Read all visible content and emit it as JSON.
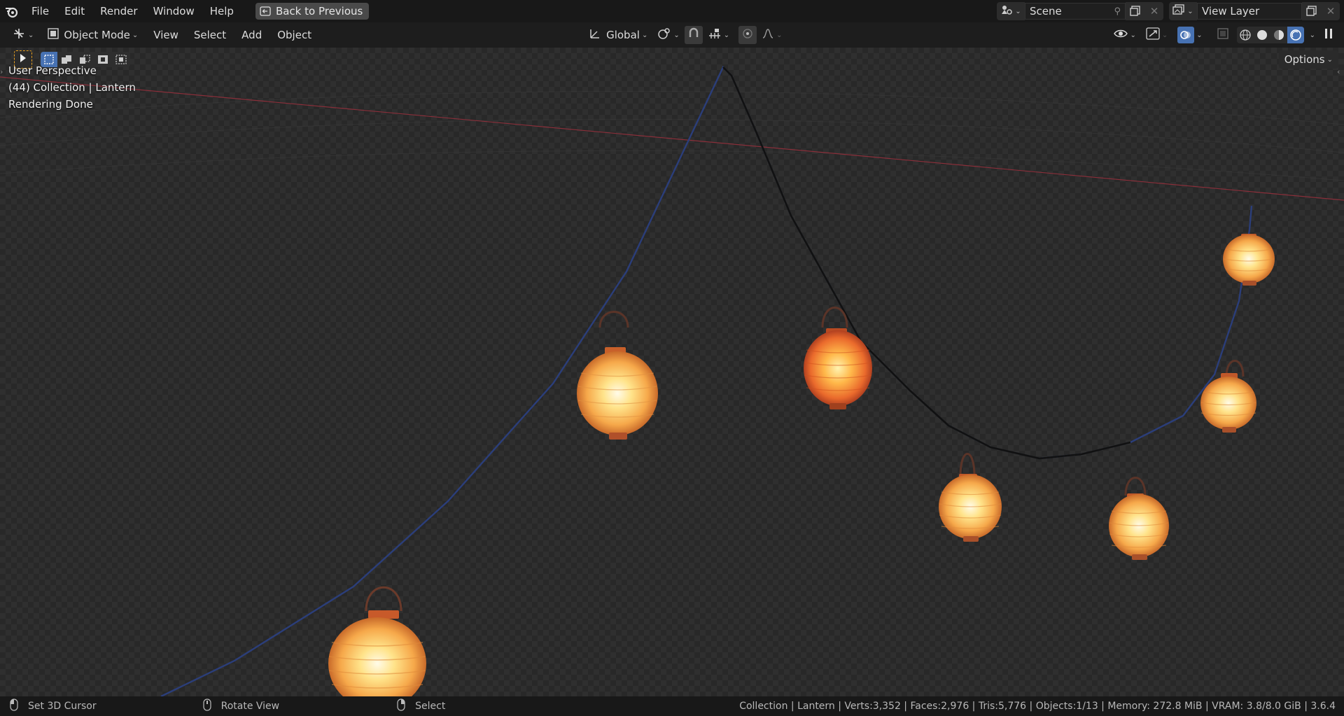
{
  "topbar": {
    "menus": [
      "File",
      "Edit",
      "Render",
      "Window",
      "Help"
    ],
    "back_button": "Back to Previous",
    "scene": {
      "name": "Scene"
    },
    "view_layer": {
      "name": "View Layer"
    }
  },
  "toolbar": {
    "mode": "Object Mode",
    "menus": [
      "View",
      "Select",
      "Add",
      "Object"
    ],
    "orientation": "Global",
    "options_label": "Options"
  },
  "viewport": {
    "overlay": {
      "line1": "User Perspective",
      "line2": "(44) Collection | Lantern",
      "line3": "Rendering Done"
    }
  },
  "statusbar": {
    "left_mouse": "Set 3D Cursor",
    "middle_mouse": "Rotate View",
    "right_mouse": "Select",
    "stats": "Collection | Lantern | Verts:3,352 | Faces:2,976 | Tris:5,776 | Objects:1/13 | Memory: 272.8 MiB | VRAM: 3.8/8.0 GiB | 3.6.4"
  },
  "colors": {
    "accent_blue": "#4772b3",
    "lantern_warm": "#f4a64a",
    "lantern_red": "#e8642a",
    "axis_red": "#8a2f3a",
    "wire_blue": "#2b3e7a"
  },
  "icons": [
    "blender-logo-icon",
    "back-icon",
    "scene-icon",
    "pin-icon",
    "new-scene-icon",
    "close-icon",
    "view-layer-icon",
    "editor-type-icon",
    "object-mode-icon",
    "transform-orientation-icon",
    "pivot-icon",
    "snap-icon",
    "proportional-edit-icon",
    "visibility-icon",
    "gizmo-icon",
    "overlay-icon",
    "xray-icon",
    "wireframe-shading-icon",
    "solid-shading-icon",
    "material-shading-icon",
    "rendered-shading-icon",
    "pause-icon",
    "select-box-icon",
    "mouse-left-icon",
    "mouse-middle-icon",
    "mouse-right-icon"
  ]
}
